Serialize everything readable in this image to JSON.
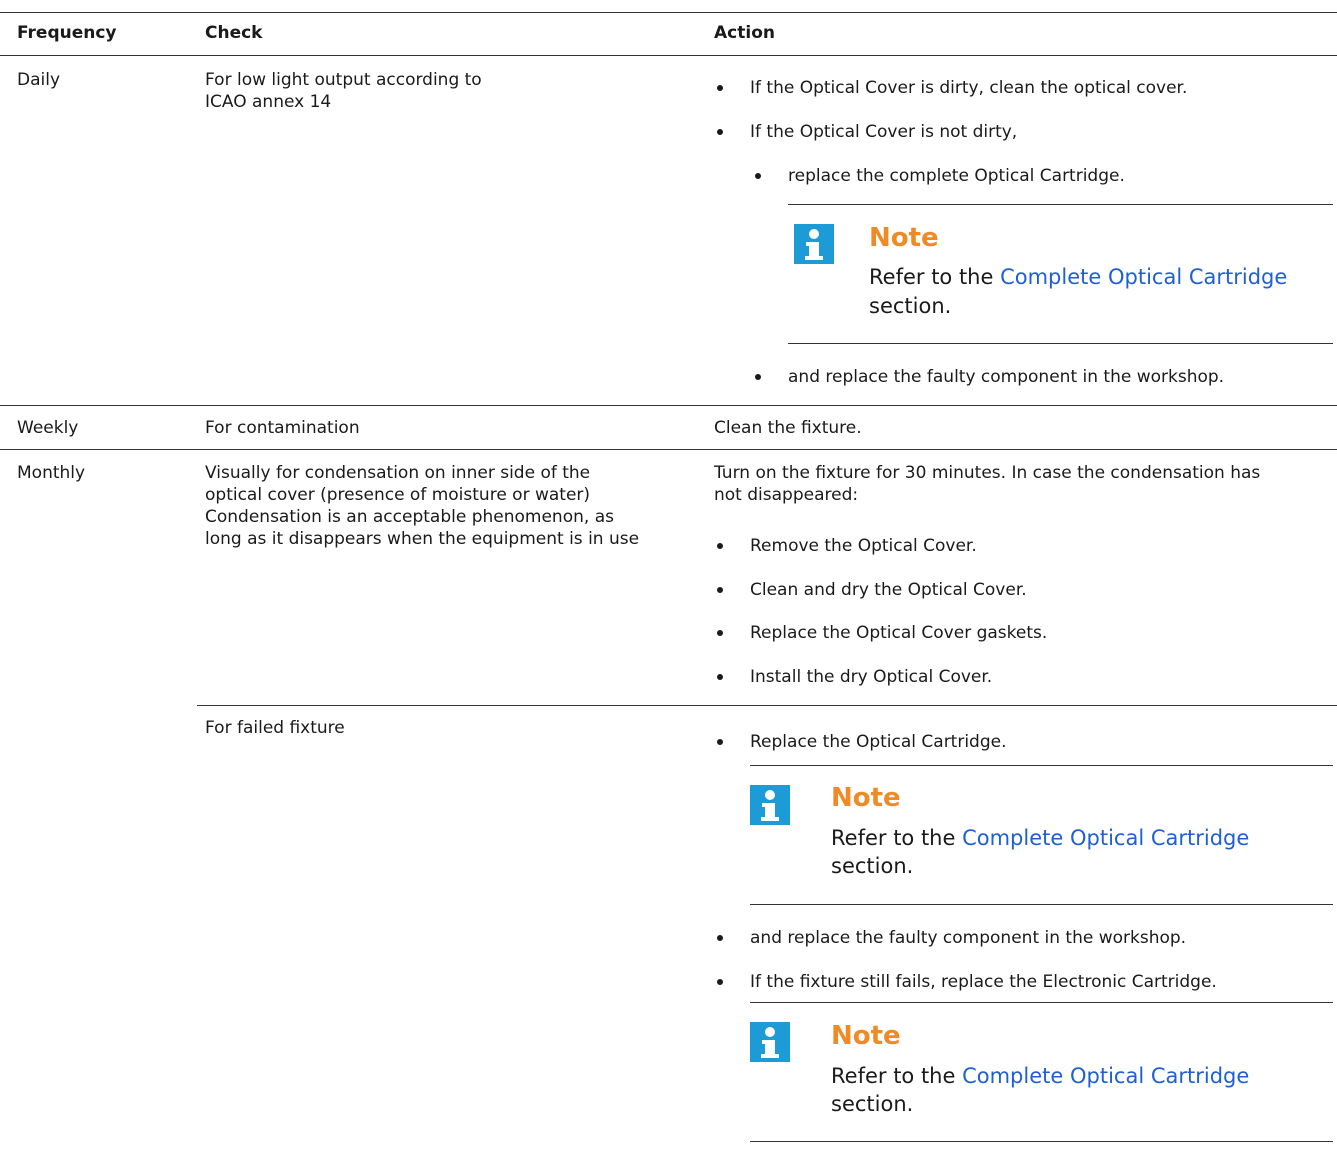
{
  "table": {
    "headers": {
      "frequency": "Frequency",
      "check": "Check",
      "action": "Action"
    },
    "rows": [
      {
        "frequency": "Daily",
        "check_line1": "For low light output according to",
        "check_line2": "ICAO annex 14",
        "action": {
          "bullet1": "If the Optical Cover is dirty, clean the optical cover.",
          "bullet2": "If the Optical Cover is not dirty,",
          "sub1": "replace the complete Optical Cartridge.",
          "note_title": "Note",
          "note_prefix": "Refer to the ",
          "note_link": "Complete Optical Cartridge",
          "note_suffix": "section.",
          "sub2": "and replace the faulty component in the workshop."
        }
      },
      {
        "frequency": "Weekly",
        "check": "For contamination",
        "action": "Clean the fixture."
      },
      {
        "frequency": "Monthly",
        "check_lines": [
          "Visually for condensation on inner side of the",
          "optical cover (presence of moisture or water)",
          "Condensation is an acceptable phenomenon, as",
          "long as it disappears when the equipment is in use"
        ],
        "action": {
          "intro_line1": "Turn on the fixture for 30 minutes. In case the condensation has",
          "intro_line2": "not disappeared:",
          "bullets": [
            "Remove the Optical Cover.",
            "Clean and dry the Optical Cover.",
            "Replace the Optical Cover gaskets.",
            "Install the dry Optical Cover."
          ]
        }
      },
      {
        "frequency": "",
        "check": "For failed fixture",
        "action": {
          "bullet1": "Replace the Optical Cartridge.",
          "note1_title": "Note",
          "note1_prefix": "Refer to the ",
          "note1_link": "Complete Optical Cartridge",
          "note1_suffix": "section.",
          "bullet2": "and replace the faulty component in the workshop.",
          "bullet3": "If the fixture still fails, replace the Electronic Cartridge.",
          "note2_title": "Note",
          "note2_prefix": "Refer to the ",
          "note2_link": "Complete Optical Cartridge",
          "note2_suffix": "section."
        }
      }
    ]
  },
  "colors": {
    "note_accent": "#f08a24",
    "info_icon": "#1d9bd7",
    "link": "#1f5fd6"
  },
  "icons": {
    "note": "info-icon"
  }
}
